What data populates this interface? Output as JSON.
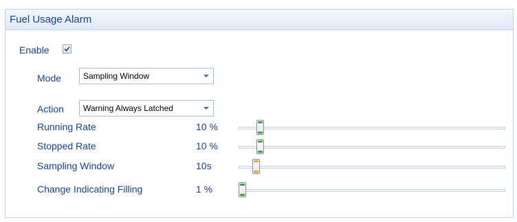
{
  "panel": {
    "title": "Fuel Usage Alarm"
  },
  "enable": {
    "label": "Enable",
    "checked": true
  },
  "mode": {
    "label": "Mode",
    "value": "Sampling Window"
  },
  "action": {
    "label": "Action",
    "value": "Warning Always Latched"
  },
  "sliders": [
    {
      "label": "Running Rate",
      "value_text": "10 %",
      "level": 0.1,
      "accent": "green"
    },
    {
      "label": "Stopped Rate",
      "value_text": "10 %",
      "level": 0.1,
      "accent": "green"
    },
    {
      "label": "Sampling Window",
      "value_text": "10s",
      "level": 0.075,
      "accent": "orange"
    },
    {
      "label": "Change Indicating Filling",
      "value_text": "1 %",
      "level": 0.0,
      "accent": "green"
    }
  ],
  "colors": {
    "header_text": "#15428b",
    "accent_green": "#3aa63a",
    "accent_orange": "#e8a23a"
  }
}
